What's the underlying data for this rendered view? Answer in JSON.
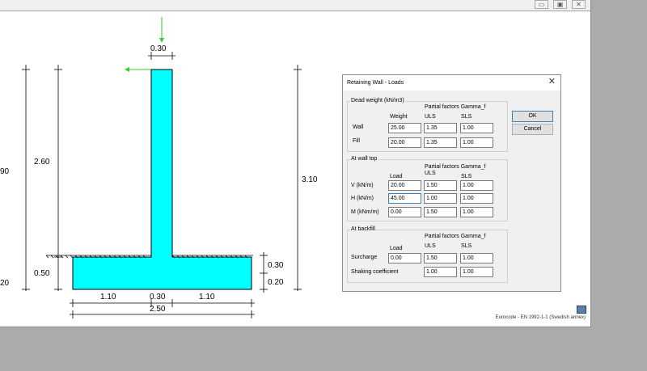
{
  "window": {
    "controls": {
      "minimize": "▭",
      "maximize": "▣",
      "close": "✕"
    }
  },
  "drawing": {
    "dims": {
      "stem_width": "0.30",
      "stem_height": "2.60",
      "total_height": "3.10",
      "left_total": "90",
      "left_base": "20",
      "foot_left": "0.50",
      "base_right_upper": "0.30",
      "base_right_lower": "0.20",
      "toe": "1.10",
      "stem_bottom": "0.30",
      "heel": "1.10",
      "total_width": "2.50"
    }
  },
  "status": {
    "text": "Eurocode - EN 1992-1-1 (Swedish annex)"
  },
  "dialog": {
    "title": "Retaining Wall - Loads",
    "close": "✕",
    "ok": "OK",
    "cancel": "Cancel",
    "dead_weight": {
      "legend": "Dead weight (kN/m3)",
      "pf_header": "Partial factors Gamma_f",
      "col_weight": "Weight",
      "col_uls": "ULS",
      "col_sls": "SLS",
      "rows": [
        {
          "label": "Wall",
          "weight": "25.00",
          "uls": "1.35",
          "sls": "1.00"
        },
        {
          "label": "Fill",
          "weight": "20.00",
          "uls": "1.35",
          "sls": "1.00"
        }
      ]
    },
    "wall_top": {
      "legend": "At wall top",
      "pf_header": "Partial factors Gamma_f",
      "col_load": "Load",
      "col_uls": "ULS",
      "col_sls": "SLS",
      "rows": [
        {
          "label": "V (kN/m)",
          "load": "20.00",
          "uls": "1.50",
          "sls": "1.00"
        },
        {
          "label": "H (kN/m)",
          "load": "45.00",
          "uls": "1.00",
          "sls": "1.00"
        },
        {
          "label": "M (kNm/m)",
          "load": "0.00",
          "uls": "1.50",
          "sls": "1.00"
        }
      ]
    },
    "backfill": {
      "legend": "At backfill",
      "pf_header": "Partial factors Gamma_f",
      "col_load": "Load",
      "col_uls": "ULS",
      "col_sls": "SLS",
      "surcharge": {
        "label": "Surcharge",
        "load": "0.00",
        "uls": "1.50",
        "sls": "1.00"
      },
      "shaking": {
        "label": "Shaking coefficient",
        "uls": "1.00",
        "sls": "1.00"
      }
    }
  },
  "colors": {
    "wall_fill": "#00ffff",
    "load_arrow": "#33cc33"
  }
}
